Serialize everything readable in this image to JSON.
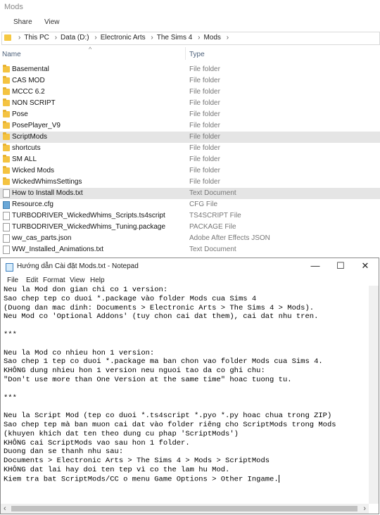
{
  "explorer": {
    "window_title": "Mods",
    "ribbon": {
      "share": "Share",
      "view": "View"
    },
    "breadcrumbs": [
      "This PC",
      "Data (D:)",
      "Electronic Arts",
      "The Sims 4",
      "Mods"
    ],
    "columns": {
      "name": "Name",
      "type": "Type"
    },
    "rows": [
      {
        "name": "Basemental",
        "type": "File folder",
        "icon": "folder-icon",
        "selected": false
      },
      {
        "name": "CAS MOD",
        "type": "File folder",
        "icon": "folder-icon",
        "selected": false
      },
      {
        "name": "MCCC 6.2",
        "type": "File folder",
        "icon": "folder-icon",
        "selected": false
      },
      {
        "name": "NON SCRIPT",
        "type": "File folder",
        "icon": "folder-icon",
        "selected": false
      },
      {
        "name": "Pose",
        "type": "File folder",
        "icon": "folder-icon",
        "selected": false
      },
      {
        "name": "PosePlayer_V9",
        "type": "File folder",
        "icon": "folder-icon",
        "selected": false
      },
      {
        "name": "ScriptMods",
        "type": "File folder",
        "icon": "folder-icon",
        "selected": true
      },
      {
        "name": "shortcuts",
        "type": "File folder",
        "icon": "folder-icon",
        "selected": false
      },
      {
        "name": "SM ALL",
        "type": "File folder",
        "icon": "folder-icon",
        "selected": false
      },
      {
        "name": "Wicked Mods",
        "type": "File folder",
        "icon": "folder-icon",
        "selected": false
      },
      {
        "name": "WickedWhimsSettings",
        "type": "File folder",
        "icon": "folder-icon",
        "selected": false
      },
      {
        "name": "How to Install Mods.txt",
        "type": "Text Document",
        "icon": "text-file-icon",
        "selected": true
      },
      {
        "name": "Resource.cfg",
        "type": "CFG File",
        "icon": "cfg-file-icon",
        "selected": false
      },
      {
        "name": "TURBODRIVER_WickedWhims_Scripts.ts4script",
        "type": "TS4SCRIPT File",
        "icon": "file-icon",
        "selected": false
      },
      {
        "name": "TURBODRIVER_WickedWhims_Tuning.package",
        "type": "PACKAGE File",
        "icon": "file-icon",
        "selected": false
      },
      {
        "name": "ww_cas_parts.json",
        "type": "Adobe After Effects JSON",
        "icon": "file-icon",
        "selected": false
      },
      {
        "name": "WW_Installed_Animations.txt",
        "type": "Text Document",
        "icon": "text-file-icon",
        "selected": false
      }
    ]
  },
  "notepad": {
    "title": "Hướng dẫn Cài đặt Mods.txt - Notepad",
    "window_buttons": {
      "minimize": "—",
      "maximize": "☐",
      "close": "✕"
    },
    "menu": [
      "File",
      "Edit",
      "Format",
      "View",
      "Help"
    ],
    "lines": [
      "Neu la Mod don gian chi co 1 version:",
      "Sao chep tep co duoi *.package vào folder Mods cua Sims 4",
      "(Duong dan mac dinh: Documents > Electronic Arts > The Sims 4 > Mods).",
      "Neu Mod co 'Optional Addons' (tuy chon cai dat them), cai dat nhu tren.",
      "",
      "***",
      "",
      "Neu la Mod co nhieu hon 1 version:",
      "Sao chep 1 tep co duoi *.package ma ban chon vao folder Mods cua Sims 4.",
      "KHÔNG dung nhieu hon 1 version neu nguoi tao da co ghi chu:",
      "\"Don't use more than One Version at the same time\" hoac tuong tu.",
      "",
      "***",
      "",
      "Neu la Script Mod (tep co duoi *.ts4script *.pyo *.py hoac chua trong ZIP)",
      "Sao chep tep mà ban muon cai dat vào folder riêng cho ScriptMods trong Mods",
      "(khuyen khich dat ten theo dung cu phap 'ScriptMods')",
      "KHÔNG cai ScriptMods vao sau hon 1 folder.",
      "Duong dan se thanh nhu sau:",
      "Documents > Electronic Arts > The Sims 4 > Mods > ScriptMods",
      "KHÔNG dat lai hay doi ten tep vì co the lam hu Mod.",
      "Kiem tra bat ScriptMods/CC o menu Game Options > Other Ingame."
    ]
  }
}
